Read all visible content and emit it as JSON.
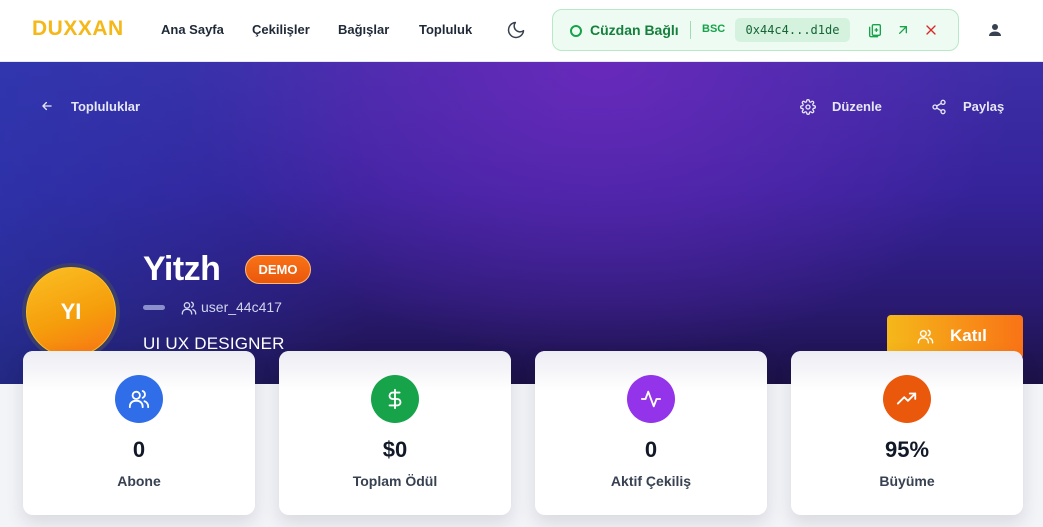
{
  "brand": {
    "logo": "DUXXAN",
    "accent_color": "#f5b81a"
  },
  "nav": {
    "links": [
      "Ana Sayfa",
      "Çekilişler",
      "Bağışlar",
      "Topluluk"
    ],
    "theme_icon": "moon-icon",
    "user_icon": "user-icon"
  },
  "wallet": {
    "status": "Cüzdan Bağlı",
    "network": "BSC",
    "address": "0x44c4...d1de",
    "status_color": "#16a34a",
    "icons": [
      "copy-icon",
      "external-link-icon",
      "disconnect-icon"
    ]
  },
  "hero": {
    "back_label": "Topluluklar",
    "edit_label": "Düzenle",
    "share_label": "Paylaş"
  },
  "profile": {
    "initials": "YI",
    "name": "Yitzh",
    "badge": "DEMO",
    "handle": "user_44c417",
    "bio": "UI UX DESIGNER",
    "join_label": "Katıl"
  },
  "stats": [
    {
      "value": "0",
      "label": "Abone",
      "icon": "users-icon",
      "color": "#2f6ee8"
    },
    {
      "value": "$0",
      "label": "Toplam Ödül",
      "icon": "dollar-icon",
      "color": "#16a34a"
    },
    {
      "value": "0",
      "label": "Aktif Çekiliş",
      "icon": "activity-icon",
      "color": "#9333ea"
    },
    {
      "value": "95%",
      "label": "Büyüme",
      "icon": "trending-up-icon",
      "color": "#ea580c"
    }
  ]
}
